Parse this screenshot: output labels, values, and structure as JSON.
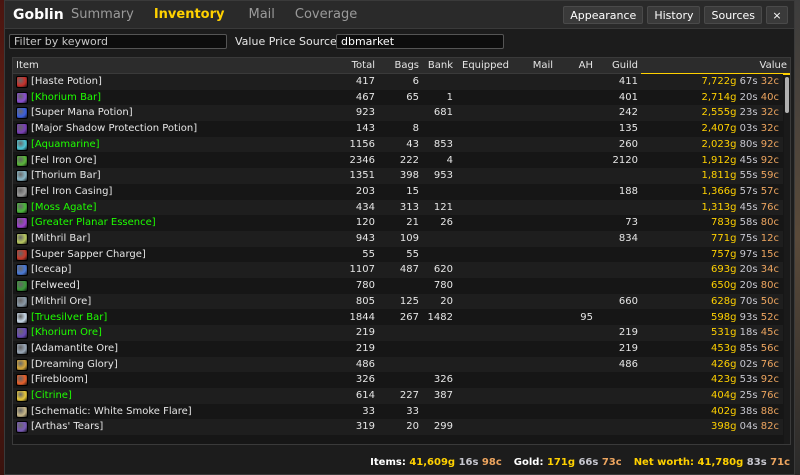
{
  "app": {
    "title": "Goblin",
    "tabs": [
      "Summary",
      "Inventory",
      "Mail",
      "Coverage"
    ],
    "active_tab": "Inventory",
    "buttons": {
      "appearance": "Appearance",
      "history": "History",
      "sources": "Sources",
      "close": "×"
    }
  },
  "filters": {
    "keyword_placeholder": "Filter by keyword",
    "value_source_label": "Value Price Source",
    "value_source_value": "dbmarket"
  },
  "columns": {
    "item": "Item",
    "total": "Total",
    "bags": "Bags",
    "bank": "Bank",
    "equipped": "Equipped",
    "mail": "Mail",
    "ah": "AH",
    "guild": "Guild",
    "value": "Value"
  },
  "rows": [
    {
      "name": "[Haste Potion]",
      "quality": "white",
      "icon": "red-potion-icon",
      "icon_color": "#c8302a",
      "total": "417",
      "bags": "6",
      "bank": "",
      "equipped": "",
      "mail": "",
      "ah": "",
      "guild": "411",
      "value": {
        "g": "7,722",
        "s": "67",
        "c": "32"
      }
    },
    {
      "name": "[Khorium Bar]",
      "quality": "green",
      "icon": "bar-icon",
      "icon_color": "#8a4fd0",
      "total": "467",
      "bags": "65",
      "bank": "1",
      "equipped": "",
      "mail": "",
      "ah": "",
      "guild": "401",
      "value": {
        "g": "2,714",
        "s": "20",
        "c": "40"
      }
    },
    {
      "name": "[Super Mana Potion]",
      "quality": "white",
      "icon": "blue-potion-icon",
      "icon_color": "#3a5fe0",
      "total": "923",
      "bags": "",
      "bank": "681",
      "equipped": "",
      "mail": "",
      "ah": "",
      "guild": "242",
      "value": {
        "g": "2,555",
        "s": "23",
        "c": "32"
      }
    },
    {
      "name": "[Major Shadow Protection Potion]",
      "quality": "white",
      "icon": "purple-potion-icon",
      "icon_color": "#7a3fb8",
      "total": "143",
      "bags": "8",
      "bank": "",
      "equipped": "",
      "mail": "",
      "ah": "",
      "guild": "135",
      "value": {
        "g": "2,407",
        "s": "03",
        "c": "32"
      }
    },
    {
      "name": "[Aquamarine]",
      "quality": "green",
      "icon": "gem-icon",
      "icon_color": "#4ec8d8",
      "total": "1156",
      "bags": "43",
      "bank": "853",
      "equipped": "",
      "mail": "",
      "ah": "",
      "guild": "260",
      "value": {
        "g": "2,023",
        "s": "80",
        "c": "92"
      }
    },
    {
      "name": "[Fel Iron Ore]",
      "quality": "white",
      "icon": "ore-icon",
      "icon_color": "#5ab83a",
      "total": "2346",
      "bags": "222",
      "bank": "4",
      "equipped": "",
      "mail": "",
      "ah": "",
      "guild": "2120",
      "value": {
        "g": "1,912",
        "s": "45",
        "c": "92"
      }
    },
    {
      "name": "[Thorium Bar]",
      "quality": "white",
      "icon": "bar-icon",
      "icon_color": "#8ab8c8",
      "total": "1351",
      "bags": "398",
      "bank": "953",
      "equipped": "",
      "mail": "",
      "ah": "",
      "guild": "",
      "value": {
        "g": "1,811",
        "s": "55",
        "c": "59"
      }
    },
    {
      "name": "[Fel Iron Casing]",
      "quality": "white",
      "icon": "casing-icon",
      "icon_color": "#9a9a9a",
      "total": "203",
      "bags": "15",
      "bank": "",
      "equipped": "",
      "mail": "",
      "ah": "",
      "guild": "188",
      "value": {
        "g": "1,366",
        "s": "57",
        "c": "57"
      }
    },
    {
      "name": "[Moss Agate]",
      "quality": "green",
      "icon": "gem-icon",
      "icon_color": "#4ab83a",
      "total": "434",
      "bags": "313",
      "bank": "121",
      "equipped": "",
      "mail": "",
      "ah": "",
      "guild": "",
      "value": {
        "g": "1,313",
        "s": "45",
        "c": "76"
      }
    },
    {
      "name": "[Greater Planar Essence]",
      "quality": "green",
      "icon": "essence-icon",
      "icon_color": "#a040d0",
      "total": "120",
      "bags": "21",
      "bank": "26",
      "equipped": "",
      "mail": "",
      "ah": "",
      "guild": "73",
      "value": {
        "g": "783",
        "s": "58",
        "c": "80"
      }
    },
    {
      "name": "[Mithril Bar]",
      "quality": "white",
      "icon": "bar-icon",
      "icon_color": "#b8c860",
      "total": "943",
      "bags": "109",
      "bank": "",
      "equipped": "",
      "mail": "",
      "ah": "",
      "guild": "834",
      "value": {
        "g": "771",
        "s": "75",
        "c": "12"
      }
    },
    {
      "name": "[Super Sapper Charge]",
      "quality": "white",
      "icon": "bomb-icon",
      "icon_color": "#c83a2a",
      "total": "55",
      "bags": "55",
      "bank": "",
      "equipped": "",
      "mail": "",
      "ah": "",
      "guild": "",
      "value": {
        "g": "757",
        "s": "97",
        "c": "15"
      }
    },
    {
      "name": "[Icecap]",
      "quality": "white",
      "icon": "herb-icon",
      "icon_color": "#4a7ad8",
      "total": "1107",
      "bags": "487",
      "bank": "620",
      "equipped": "",
      "mail": "",
      "ah": "",
      "guild": "",
      "value": {
        "g": "693",
        "s": "20",
        "c": "34"
      }
    },
    {
      "name": "[Felweed]",
      "quality": "white",
      "icon": "herb-icon",
      "icon_color": "#3a9a3a",
      "total": "780",
      "bags": "",
      "bank": "780",
      "equipped": "",
      "mail": "",
      "ah": "",
      "guild": "",
      "value": {
        "g": "650",
        "s": "20",
        "c": "80"
      }
    },
    {
      "name": "[Mithril Ore]",
      "quality": "white",
      "icon": "ore-icon",
      "icon_color": "#8a9aa8",
      "total": "805",
      "bags": "125",
      "bank": "20",
      "equipped": "",
      "mail": "",
      "ah": "",
      "guild": "660",
      "value": {
        "g": "628",
        "s": "70",
        "c": "50"
      }
    },
    {
      "name": "[Truesilver Bar]",
      "quality": "green",
      "icon": "bar-icon",
      "icon_color": "#c8d8e8",
      "total": "1844",
      "bags": "267",
      "bank": "1482",
      "equipped": "",
      "mail": "",
      "ah": "95",
      "guild": "",
      "value": {
        "g": "598",
        "s": "93",
        "c": "52"
      }
    },
    {
      "name": "[Khorium Ore]",
      "quality": "green",
      "icon": "ore-icon",
      "icon_color": "#6a4ab8",
      "total": "219",
      "bags": "",
      "bank": "",
      "equipped": "",
      "mail": "",
      "ah": "",
      "guild": "219",
      "value": {
        "g": "531",
        "s": "18",
        "c": "45"
      }
    },
    {
      "name": "[Adamantite Ore]",
      "quality": "white",
      "icon": "ore-icon",
      "icon_color": "#9aa8b8",
      "total": "219",
      "bags": "",
      "bank": "",
      "equipped": "",
      "mail": "",
      "ah": "",
      "guild": "219",
      "value": {
        "g": "453",
        "s": "85",
        "c": "56"
      }
    },
    {
      "name": "[Dreaming Glory]",
      "quality": "white",
      "icon": "herb-icon",
      "icon_color": "#d8a83a",
      "total": "486",
      "bags": "",
      "bank": "",
      "equipped": "",
      "mail": "",
      "ah": "",
      "guild": "486",
      "value": {
        "g": "426",
        "s": "02",
        "c": "76"
      }
    },
    {
      "name": "[Firebloom]",
      "quality": "white",
      "icon": "herb-icon",
      "icon_color": "#e8602a",
      "total": "326",
      "bags": "",
      "bank": "326",
      "equipped": "",
      "mail": "",
      "ah": "",
      "guild": "",
      "value": {
        "g": "423",
        "s": "53",
        "c": "92"
      }
    },
    {
      "name": "[Citrine]",
      "quality": "green",
      "icon": "gem-icon",
      "icon_color": "#e8c83a",
      "total": "614",
      "bags": "227",
      "bank": "387",
      "equipped": "",
      "mail": "",
      "ah": "",
      "guild": "",
      "value": {
        "g": "404",
        "s": "25",
        "c": "76"
      }
    },
    {
      "name": "[Schematic: White Smoke Flare]",
      "quality": "white",
      "icon": "scroll-icon",
      "icon_color": "#c8b88a",
      "total": "33",
      "bags": "33",
      "bank": "",
      "equipped": "",
      "mail": "",
      "ah": "",
      "guild": "",
      "value": {
        "g": "402",
        "s": "38",
        "c": "88"
      }
    },
    {
      "name": "[Arthas' Tears]",
      "quality": "white",
      "icon": "herb-icon",
      "icon_color": "#7a5ab8",
      "total": "319",
      "bags": "20",
      "bank": "299",
      "equipped": "",
      "mail": "",
      "ah": "",
      "guild": "",
      "value": {
        "g": "398",
        "s": "04",
        "c": "82"
      }
    }
  ],
  "footer": {
    "items_label": "Items:",
    "items": {
      "g": "41,609",
      "s": "16",
      "c": "98"
    },
    "gold_label": "Gold:",
    "gold": {
      "g": "171",
      "s": "66",
      "c": "73"
    },
    "net_worth_label": "Net worth:",
    "net_worth": {
      "g": "41,780",
      "s": "83",
      "c": "71"
    }
  },
  "colors": {
    "accent": "#ffd100",
    "uncommon": "#1eff00",
    "silver": "#c7c7cf",
    "copper": "#eda55f"
  }
}
